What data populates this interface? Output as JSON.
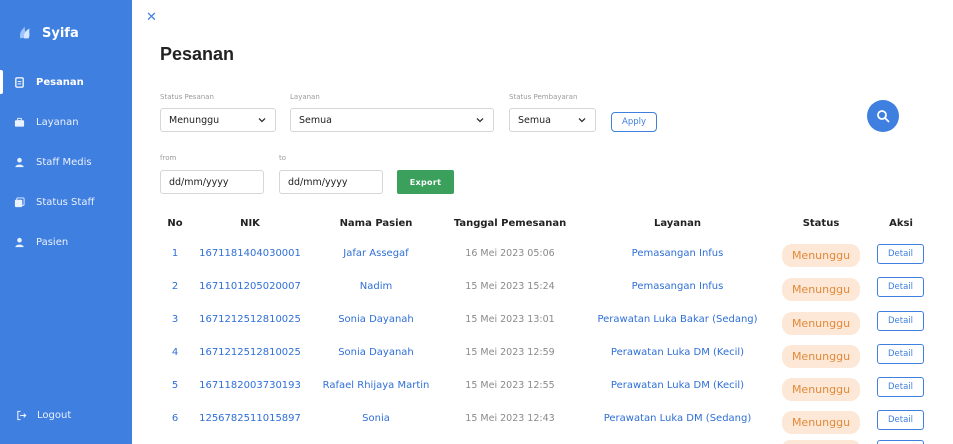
{
  "app": {
    "name": "Syifa"
  },
  "sidebar": {
    "items": [
      {
        "label": "Pesanan",
        "icon": "document-icon",
        "active": true
      },
      {
        "label": "Layanan",
        "icon": "briefcase-icon",
        "active": false
      },
      {
        "label": "Staff Medis",
        "icon": "user-icon",
        "active": false
      },
      {
        "label": "Status Staff",
        "icon": "layers-icon",
        "active": false
      },
      {
        "label": "Pasien",
        "icon": "user-icon",
        "active": false
      }
    ],
    "logout_label": "Logout"
  },
  "page": {
    "title": "Pesanan"
  },
  "filters": {
    "status_pesanan": {
      "label": "Status Pesanan",
      "value": "Menunggu"
    },
    "layanan": {
      "label": "Layanan",
      "value": "Semua"
    },
    "status_pembayaran": {
      "label": "Status Pembayaran",
      "value": "Semua"
    },
    "apply_label": "Apply",
    "from": {
      "label": "from",
      "placeholder": "dd/mm/yyyy"
    },
    "to": {
      "label": "to",
      "placeholder": "dd/mm/yyyy"
    },
    "export_label": "Export"
  },
  "table": {
    "headers": {
      "no": "No",
      "nik": "NIK",
      "nama": "Nama Pasien",
      "tanggal": "Tanggal Pemesanan",
      "layanan": "Layanan",
      "status": "Status",
      "aksi": "Aksi"
    },
    "rows": [
      {
        "no": "1",
        "nik": "1671181404030001",
        "nama": "Jafar Assegaf",
        "tanggal": "16 Mei 2023 05:06",
        "layanan": "Pemasangan Infus",
        "status": "Menunggu",
        "aksi": "Detail"
      },
      {
        "no": "2",
        "nik": "1671101205020007",
        "nama": "Nadim",
        "tanggal": "15 Mei 2023 15:24",
        "layanan": "Pemasangan Infus",
        "status": "Menunggu",
        "aksi": "Detail"
      },
      {
        "no": "3",
        "nik": "1671212512810025",
        "nama": "Sonia Dayanah",
        "tanggal": "15 Mei 2023 13:01",
        "layanan": "Perawatan Luka Bakar (Sedang)",
        "status": "Menunggu",
        "aksi": "Detail"
      },
      {
        "no": "4",
        "nik": "1671212512810025",
        "nama": "Sonia Dayanah",
        "tanggal": "15 Mei 2023 12:59",
        "layanan": "Perawatan Luka DM (Kecil)",
        "status": "Menunggu",
        "aksi": "Detail"
      },
      {
        "no": "5",
        "nik": "1671182003730193",
        "nama": "Rafael Rhijaya Martin",
        "tanggal": "15 Mei 2023 12:55",
        "layanan": "Perawatan Luka DM (Kecil)",
        "status": "Menunggu",
        "aksi": "Detail"
      },
      {
        "no": "6",
        "nik": "1256782511015897",
        "nama": "Sonia",
        "tanggal": "15 Mei 2023 12:43",
        "layanan": "Perawatan Luka DM (Sedang)",
        "status": "Menunggu",
        "aksi": "Detail"
      }
    ]
  },
  "colors": {
    "primary": "#3f7fe0",
    "export": "#3aa05b",
    "badge_bg": "#fde7d6",
    "badge_text": "#e08a3a"
  }
}
